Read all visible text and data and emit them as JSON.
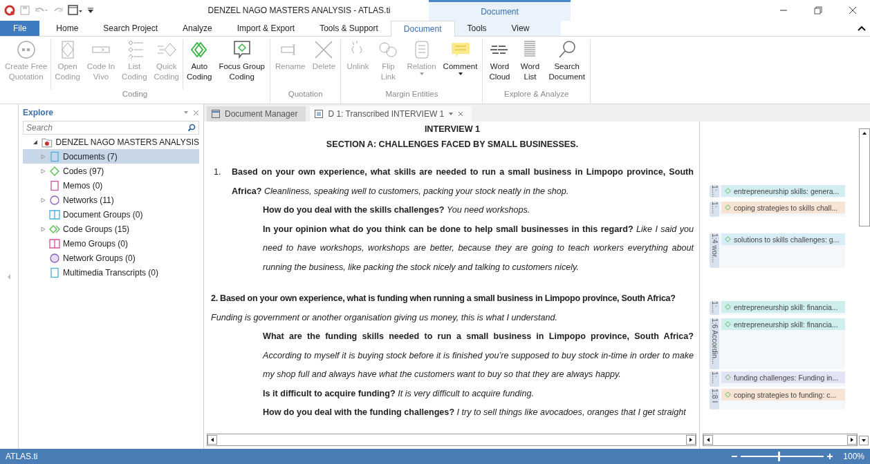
{
  "window": {
    "title": "DENZEL NAGO MASTERS ANALYSIS - ATLAS.ti",
    "context_header": "Document"
  },
  "menu_tabs": [
    {
      "label": "File",
      "selected": false,
      "kind": "file",
      "contextual": false
    },
    {
      "label": "Home",
      "selected": false,
      "kind": "tab",
      "contextual": false
    },
    {
      "label": "Search Project",
      "selected": false,
      "kind": "tab",
      "contextual": false
    },
    {
      "label": "Analyze",
      "selected": false,
      "kind": "tab",
      "contextual": false
    },
    {
      "label": "Import & Export",
      "selected": false,
      "kind": "tab",
      "contextual": false
    },
    {
      "label": "Tools & Support",
      "selected": false,
      "kind": "tab",
      "contextual": false
    },
    {
      "label": "Document",
      "selected": true,
      "kind": "tab",
      "contextual": true
    },
    {
      "label": "Tools",
      "selected": false,
      "kind": "tab",
      "contextual": true
    },
    {
      "label": "View",
      "selected": false,
      "kind": "tab",
      "contextual": true
    }
  ],
  "ribbon": [
    {
      "label": "Coding",
      "buttons": [
        {
          "lines": [
            "Create Free",
            "Quotation"
          ],
          "disabled": true,
          "dropdown": false
        },
        {
          "lines": [
            "Open",
            "Coding"
          ],
          "disabled": true,
          "dropdown": false
        },
        {
          "lines": [
            "Code In",
            "Vivo"
          ],
          "disabled": true,
          "dropdown": false
        },
        {
          "lines": [
            "List",
            "Coding"
          ],
          "disabled": true,
          "dropdown": false
        },
        {
          "lines": [
            "Quick",
            "Coding"
          ],
          "disabled": true,
          "dropdown": false
        },
        {
          "lines": [
            "Auto",
            "Coding"
          ],
          "disabled": false,
          "dropdown": false
        },
        {
          "lines": [
            "Focus Group",
            "Coding"
          ],
          "disabled": false,
          "dropdown": false
        }
      ]
    },
    {
      "label": "Quotation",
      "buttons": [
        {
          "lines": [
            "Rename"
          ],
          "disabled": true,
          "dropdown": false
        },
        {
          "lines": [
            "Delete"
          ],
          "disabled": true,
          "dropdown": false
        }
      ]
    },
    {
      "label": "Margin Entities",
      "buttons": [
        {
          "lines": [
            "Unlink"
          ],
          "disabled": true,
          "dropdown": false
        },
        {
          "lines": [
            "Flip",
            "Link"
          ],
          "disabled": true,
          "dropdown": false
        },
        {
          "lines": [
            "Relation"
          ],
          "disabled": true,
          "dropdown": true
        },
        {
          "lines": [
            "Comment"
          ],
          "disabled": false,
          "dropdown": true
        }
      ]
    },
    {
      "label": "Explore & Analyze",
      "buttons": [
        {
          "lines": [
            "Word",
            "Cloud"
          ],
          "disabled": false,
          "dropdown": false
        },
        {
          "lines": [
            "Word",
            "List"
          ],
          "disabled": false,
          "dropdown": false
        },
        {
          "lines": [
            "Search",
            "Document"
          ],
          "disabled": false,
          "dropdown": false
        }
      ]
    }
  ],
  "explore": {
    "title": "Explore",
    "search": {
      "placeholder": "Search"
    },
    "tree": [
      {
        "label": "DENZEL NAGO MASTERS ANALYSIS",
        "expanded": true,
        "selected": false,
        "children": [
          {
            "label": "Documents (7)",
            "selected": true,
            "expandable": true
          },
          {
            "label": "Codes (97)",
            "selected": false,
            "expandable": true
          },
          {
            "label": "Memos (0)",
            "selected": false,
            "expandable": false
          },
          {
            "label": "Networks (11)",
            "selected": false,
            "expandable": true
          },
          {
            "label": "Document Groups (0)",
            "selected": false,
            "expandable": false
          },
          {
            "label": "Code Groups (15)",
            "selected": false,
            "expandable": true
          },
          {
            "label": "Memo Groups (0)",
            "selected": false,
            "expandable": false
          },
          {
            "label": "Network Groups (0)",
            "selected": false,
            "expandable": false
          },
          {
            "label": "Multimedia Transcripts (0)",
            "selected": false,
            "expandable": false
          }
        ]
      }
    ]
  },
  "doc_tabs": [
    {
      "label": "Document Manager",
      "selected": false
    },
    {
      "label": "D 1: Transcribed INTERVIEW 1",
      "selected": true
    }
  ],
  "document": {
    "heading": "INTERVIEW 1",
    "subheading": "SECTION A: CHALLENGES FACED BY SMALL BUSINESSES.",
    "paragraphs": [
      {
        "kind": "numbered",
        "number": "1.",
        "text": "**Based on your own experience, what skills are needed to run a small business in Limpopo province, South Africa?** *Cleanliness, speaking well to customers, packing your stock neatly in the shop.*"
      },
      {
        "kind": "sub",
        "text": "**How do you deal with the skills challenges?** *You need workshops.*"
      },
      {
        "kind": "sub",
        "text": "**In your opinion what do you think can be done to help small businesses in this regard?** *Like I said you need to have workshops, workshops are better, because they are going to teach workers everything about running the business, like packing the stock nicely and talking to customers nicely.*"
      },
      {
        "kind": "bold",
        "text": "2. Based on your own experience, what is funding when running a small business in Limpopo province, South Africa?"
      },
      {
        "kind": "answer",
        "text": "Funding is government or another organisation giving us money, this is what I understand."
      },
      {
        "kind": "sub",
        "text": "**What are the funding skills needed to run a small business in Limpopo province, South Africa?** *According to myself it is buying stock before it is finished you’re supposed to buy stock in-time in order to make my shop full and always have what the customers want to buy so that they are always happy.*"
      },
      {
        "kind": "sub",
        "text": "**Is it difficult to acquire funding?** *It is very difficult to acquire funding.*"
      },
      {
        "kind": "sub",
        "text": "**How do you deal with the funding challenges?** *I try to sell things like avocadoes, oranges that I get straight*"
      }
    ]
  },
  "margin": [
    {
      "label": "1:...",
      "codes": [
        {
          "text": "entrepreneurship skills: genera...",
          "color": "#d3edf3"
        }
      ]
    },
    {
      "label": "1:...",
      "codes": [
        {
          "text": "coping strategies to skills chall...",
          "color": "#f7e4d4"
        }
      ]
    },
    {
      "label": "1:4 wor...",
      "codes": [
        {
          "text": "solutions to skills challenges: g...",
          "color": "#d8ecf6"
        }
      ]
    },
    {
      "label": "1:...",
      "codes": [
        {
          "text": "entrepreneurship skill: financia...",
          "color": "#cfeeee"
        }
      ]
    },
    {
      "label": "1:6 Accordin...",
      "codes": [
        {
          "text": "entrepreneurship skill: financia...",
          "color": "#cfeeee"
        }
      ]
    },
    {
      "label": "1:...",
      "codes": [
        {
          "text": "funding challenges: Funding in...",
          "color": "#e3e3f6"
        }
      ]
    },
    {
      "label": "1:8 I",
      "codes": [
        {
          "text": "coping strategies to funding: c...",
          "color": "#f7e4d4"
        }
      ]
    }
  ],
  "status_bar": {
    "app": "ATLAS.ti",
    "zoom": {
      "level": 0.45,
      "reading": "100%"
    }
  }
}
